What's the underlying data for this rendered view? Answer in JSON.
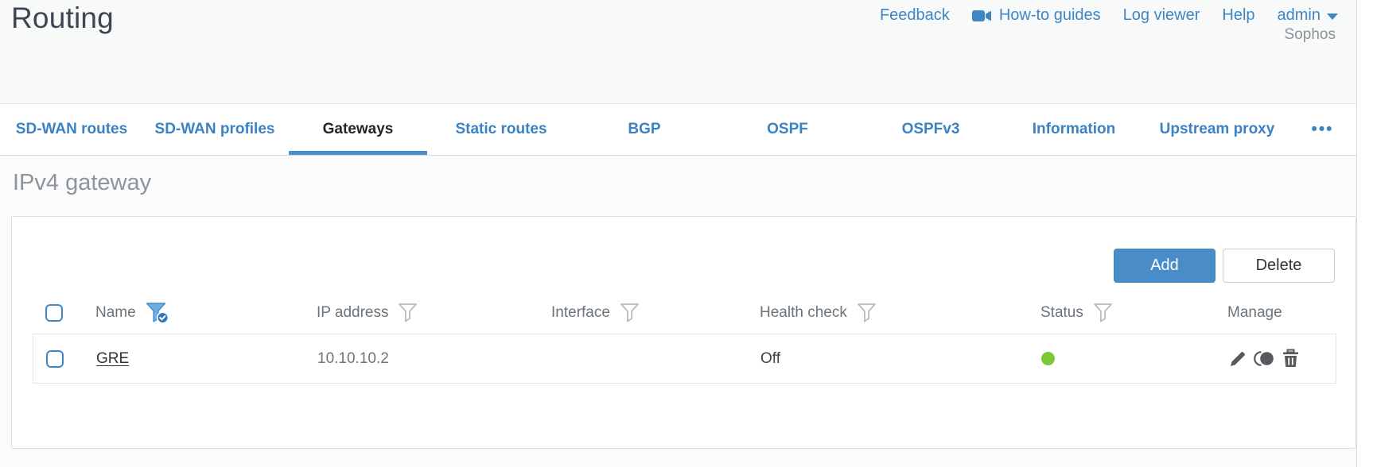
{
  "header": {
    "title": "Routing",
    "links": [
      {
        "label": "Feedback"
      },
      {
        "label": "How-to guides",
        "icon": "video-camera-icon"
      },
      {
        "label": "Log viewer"
      },
      {
        "label": "Help"
      }
    ],
    "user": "admin",
    "brand": "Sophos"
  },
  "tabs": {
    "items": [
      {
        "label": "SD-WAN routes",
        "active": false
      },
      {
        "label": "SD-WAN profiles",
        "active": false
      },
      {
        "label": "Gateways",
        "active": true
      },
      {
        "label": "Static routes",
        "active": false
      },
      {
        "label": "BGP",
        "active": false
      },
      {
        "label": "OSPF",
        "active": false
      },
      {
        "label": "OSPFv3",
        "active": false
      },
      {
        "label": "Information",
        "active": false
      },
      {
        "label": "Upstream proxy",
        "active": false
      }
    ],
    "more": "•••"
  },
  "section": {
    "title": "IPv4 gateway"
  },
  "toolbar": {
    "add_label": "Add",
    "delete_label": "Delete"
  },
  "table": {
    "columns": [
      {
        "label": "Name",
        "filter": "active"
      },
      {
        "label": "IP address",
        "filter": "plain"
      },
      {
        "label": "Interface",
        "filter": "plain"
      },
      {
        "label": "Health check",
        "filter": "plain"
      },
      {
        "label": "Status",
        "filter": "plain"
      },
      {
        "label": "Manage",
        "filter": "none"
      }
    ],
    "rows": [
      {
        "name": "GRE",
        "ip_address": "10.10.10.2",
        "interface": "",
        "health_check": "Off",
        "status": "green"
      }
    ]
  },
  "colors": {
    "link_blue": "#3e86c6",
    "tab_active_underline": "#4a90ce",
    "add_button": "#4a8cc8",
    "status_green": "#7cc838",
    "heading_gray": "#8d959d",
    "manage_icon_gray": "#58595c"
  }
}
